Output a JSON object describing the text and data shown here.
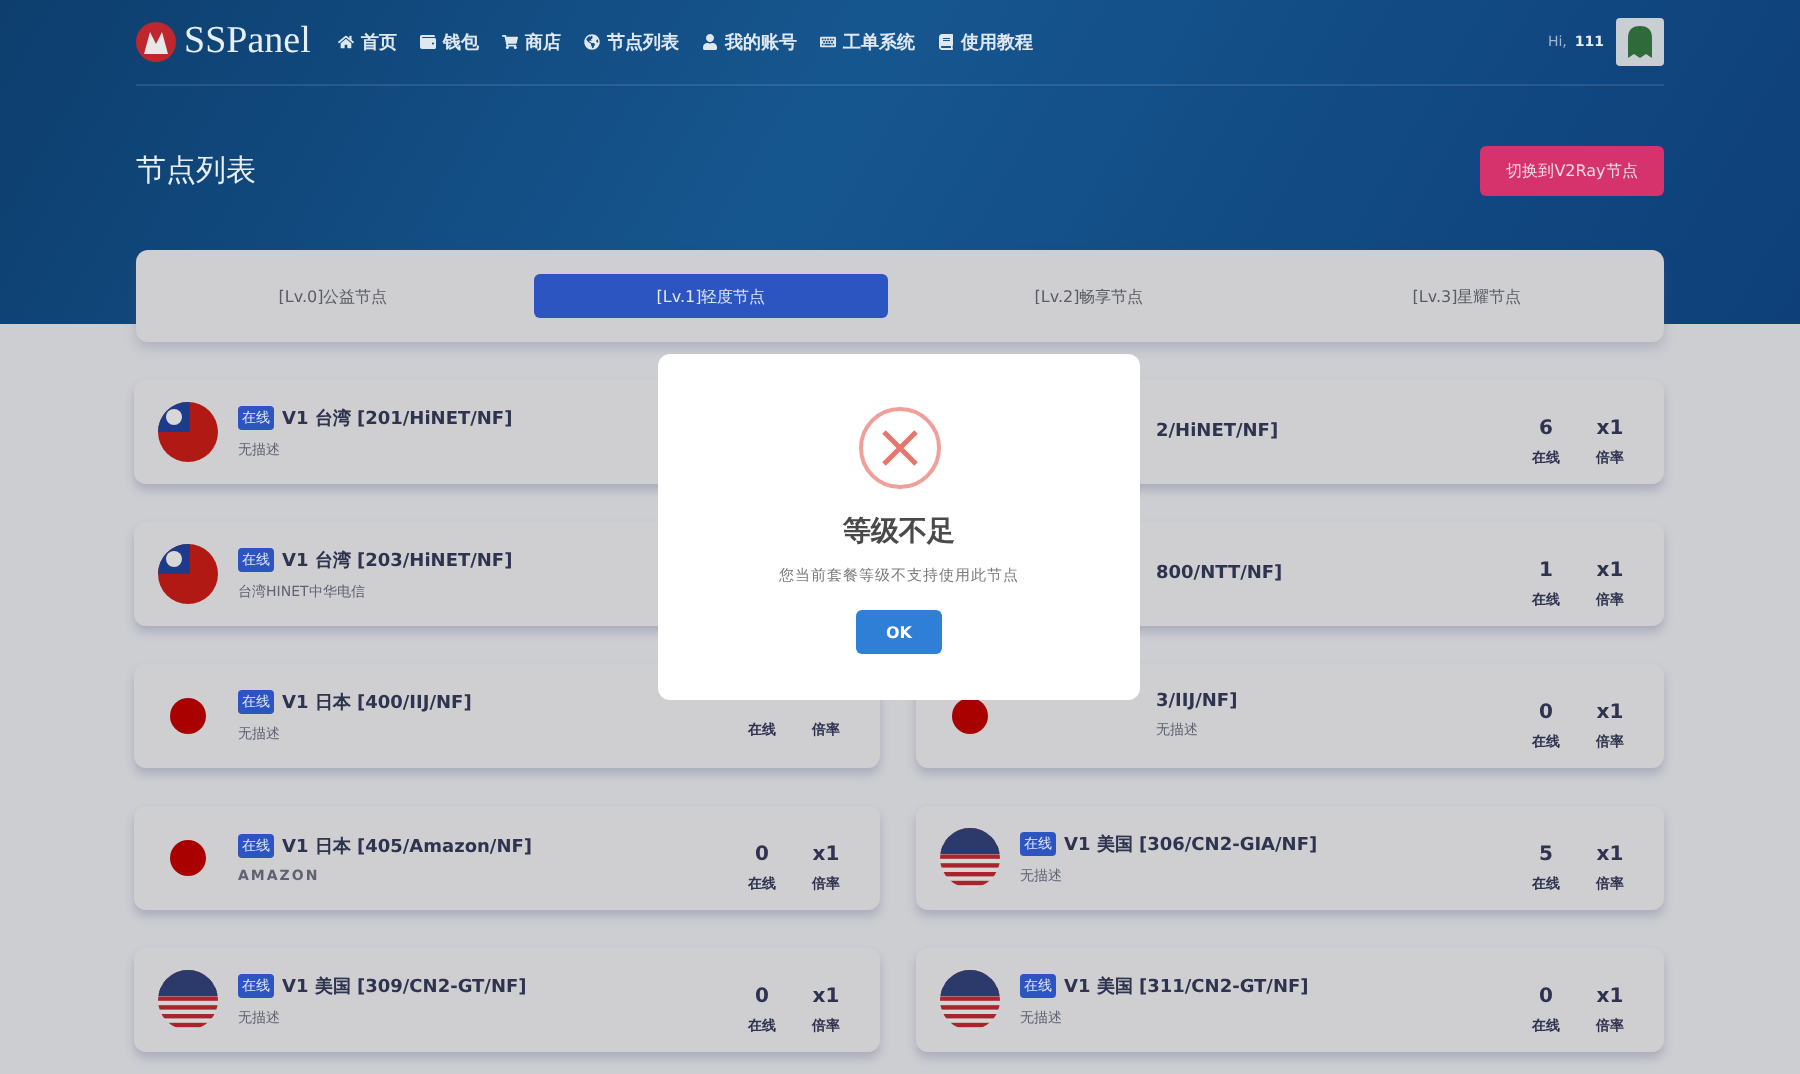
{
  "brand": "SSPanel",
  "nav": [
    {
      "label": "首页",
      "kind": "home"
    },
    {
      "label": "钱包",
      "kind": "wallet"
    },
    {
      "label": "商店",
      "kind": "cart"
    },
    {
      "label": "节点列表",
      "kind": "globe"
    },
    {
      "label": "我的账号",
      "kind": "user"
    },
    {
      "label": "工单系统",
      "kind": "keyboard"
    },
    {
      "label": "使用教程",
      "kind": "book"
    }
  ],
  "user": {
    "greeting": "Hi,",
    "name": "111"
  },
  "page_title": "节点列表",
  "switch_button": "切换到V2Ray节点",
  "tabs": [
    {
      "label": "[Lv.0]公益节点",
      "selected": false
    },
    {
      "label": "[Lv.1]轻度节点",
      "selected": true
    },
    {
      "label": "[Lv.2]畅享节点",
      "selected": false
    },
    {
      "label": "[Lv.3]星耀节点",
      "selected": false
    }
  ],
  "nodes": [
    {
      "kind": "tw",
      "badge": "在线",
      "name": "V1 台湾 [201/HiNET/NF]",
      "desc": "无描述"
    },
    {
      "name": "2/HiNET/NF]",
      "online": "6",
      "online_label": "在线",
      "rate": "x1",
      "rate_label": "倍率"
    },
    {
      "kind": "tw",
      "badge": "在线",
      "name": "V1 台湾 [203/HiNET/NF]",
      "desc": "台湾HINET中华电信"
    },
    {
      "name": "800/NTT/NF]",
      "online": "1",
      "online_label": "在线",
      "rate": "x1",
      "rate_label": "倍率"
    },
    {
      "kind": "jp",
      "badge": "在线",
      "name": "V1 日本 [400/IIJ/NF]",
      "desc": "无描述",
      "online_label": "在线",
      "rate_label": "倍率"
    },
    {
      "kind": "jp",
      "name": "3/IIJ/NF]",
      "desc": "无描述",
      "online": "0",
      "online_label": "在线",
      "rate": "x1",
      "rate_label": "倍率"
    },
    {
      "kind": "jp",
      "badge": "在线",
      "name": "V1 日本 [405/Amazon/NF]",
      "desc": "AMAZON",
      "online": "0",
      "online_label": "在线",
      "rate": "x1",
      "rate_label": "倍率"
    },
    {
      "kind": "us",
      "badge": "在线",
      "name": "V1 美国 [306/CN2-GIA/NF]",
      "desc": "无描述",
      "online": "5",
      "online_label": "在线",
      "rate": "x1",
      "rate_label": "倍率"
    },
    {
      "kind": "us",
      "badge": "在线",
      "name": "V1 美国 [309/CN2-GT/NF]",
      "desc": "无描述",
      "online": "0",
      "online_label": "在线",
      "rate": "x1",
      "rate_label": "倍率"
    },
    {
      "kind": "us",
      "badge": "在线",
      "name": "V1 美国 [311/CN2-GT/NF]",
      "desc": "无描述",
      "online": "0",
      "online_label": "在线",
      "rate": "x1",
      "rate_label": "倍率"
    }
  ],
  "dialog": {
    "title": "等级不足",
    "message": "您当前套餐等级不支持使用此节点",
    "button": "OK"
  }
}
